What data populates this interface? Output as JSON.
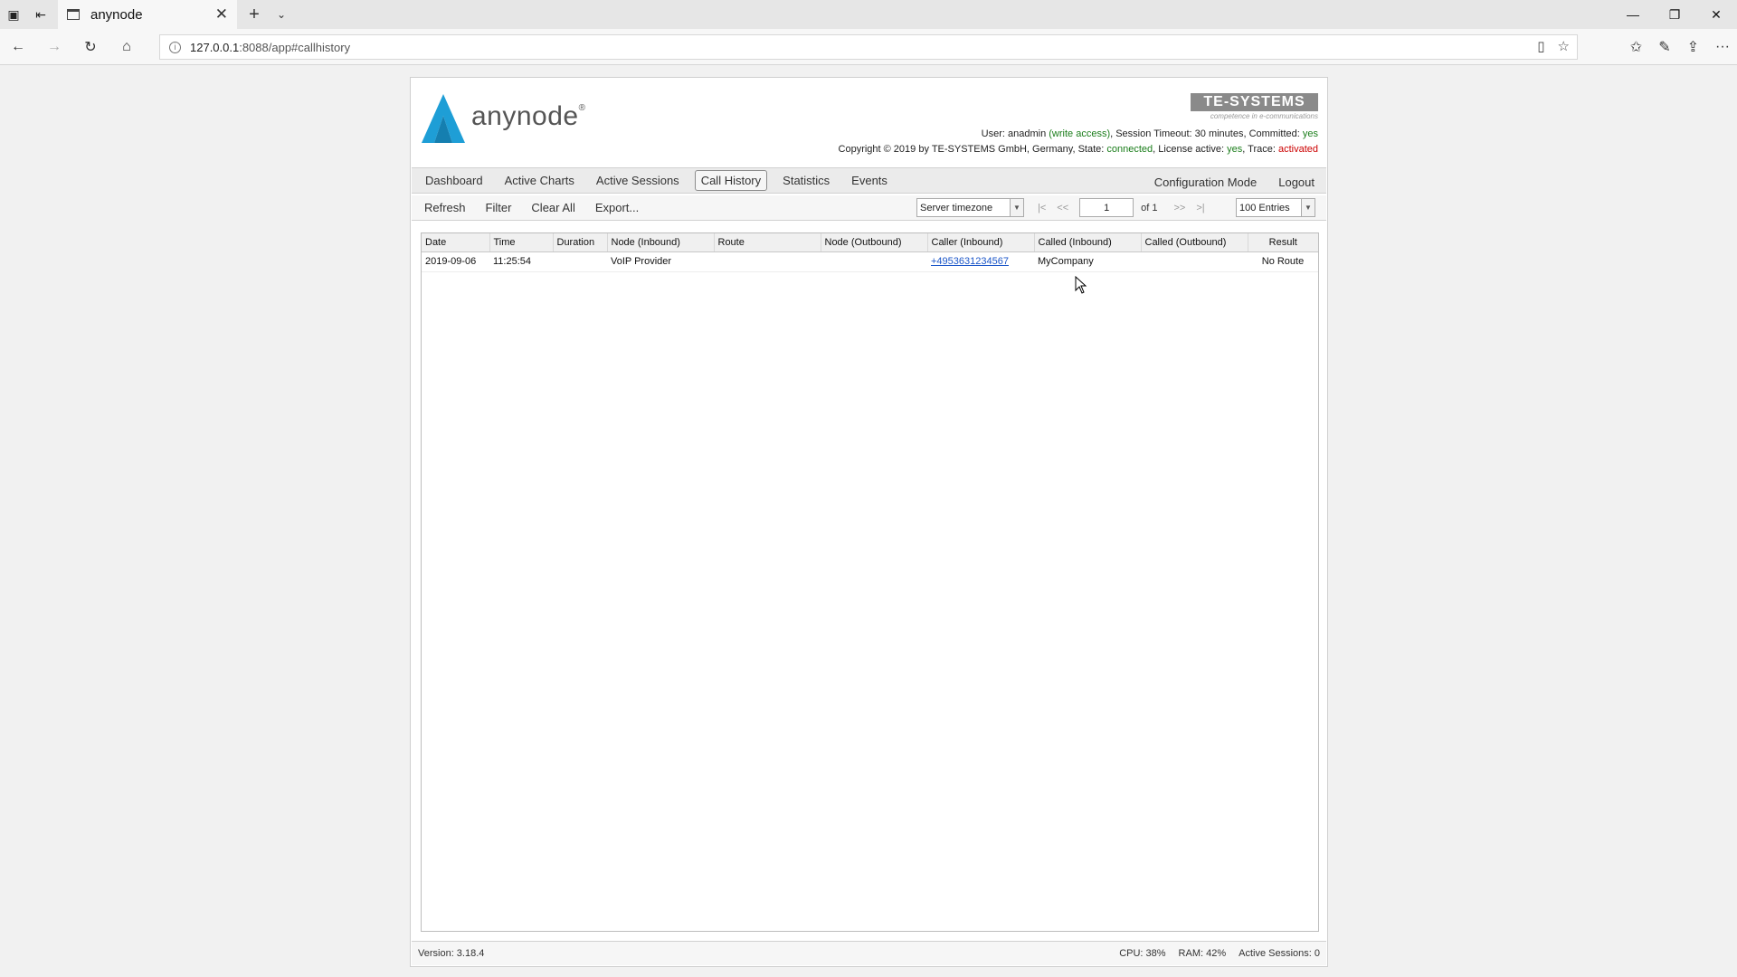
{
  "browser": {
    "tab_title": "anynode",
    "url_host": "127.0.0.1",
    "url_rest": ":8088/app#callhistory"
  },
  "header": {
    "logo_text": "anynode",
    "logo_reg": "®",
    "brand_name": "TE-SYSTEMS",
    "brand_tagline": "competence in e-communications",
    "user_label": "User: ",
    "user_name": "anadmin",
    "access": "(write access)",
    "session_label": ", Session Timeout: 30 minutes, Committed: ",
    "committed": "yes",
    "copyright": "Copyright © 2019 by TE-SYSTEMS GmbH, Germany, State: ",
    "state": "connected",
    "license_label": ", License active: ",
    "license": "yes",
    "trace_label": ", Trace: ",
    "trace": "activated"
  },
  "menu": {
    "items": [
      "Dashboard",
      "Active Charts",
      "Active Sessions",
      "Call History",
      "Statistics",
      "Events"
    ],
    "right_items": [
      "Configuration Mode",
      "Logout"
    ]
  },
  "toolbar": {
    "buttons": [
      "Refresh",
      "Filter",
      "Clear All",
      "Export..."
    ],
    "timezone": "Server timezone",
    "page_first": "|<",
    "page_prev": "<<",
    "page_value": "1",
    "page_of": "of  1",
    "page_next": ">>",
    "page_last": ">|",
    "entries": "100 Entries"
  },
  "table": {
    "columns": [
      "Date",
      "Time",
      "Duration",
      "Node (Inbound)",
      "Route",
      "Node (Outbound)",
      "Caller (Inbound)",
      "Called (Inbound)",
      "Called (Outbound)",
      "Result"
    ],
    "rows": [
      [
        "2019-09-06",
        "11:25:54",
        "",
        "VoIP Provider",
        "",
        "",
        "+4953631234567",
        "MyCompany",
        "",
        "No Route"
      ]
    ]
  },
  "footer": {
    "version": "Version:  3.18.4",
    "cpu": "CPU: 38%",
    "ram": "RAM: 42%",
    "sessions": "Active Sessions: 0"
  },
  "colors": {
    "logo_blue": "#1e9ed6",
    "status_green": "#1a7d1a",
    "status_red": "#cc0000",
    "link_blue": "#1a55c8"
  }
}
